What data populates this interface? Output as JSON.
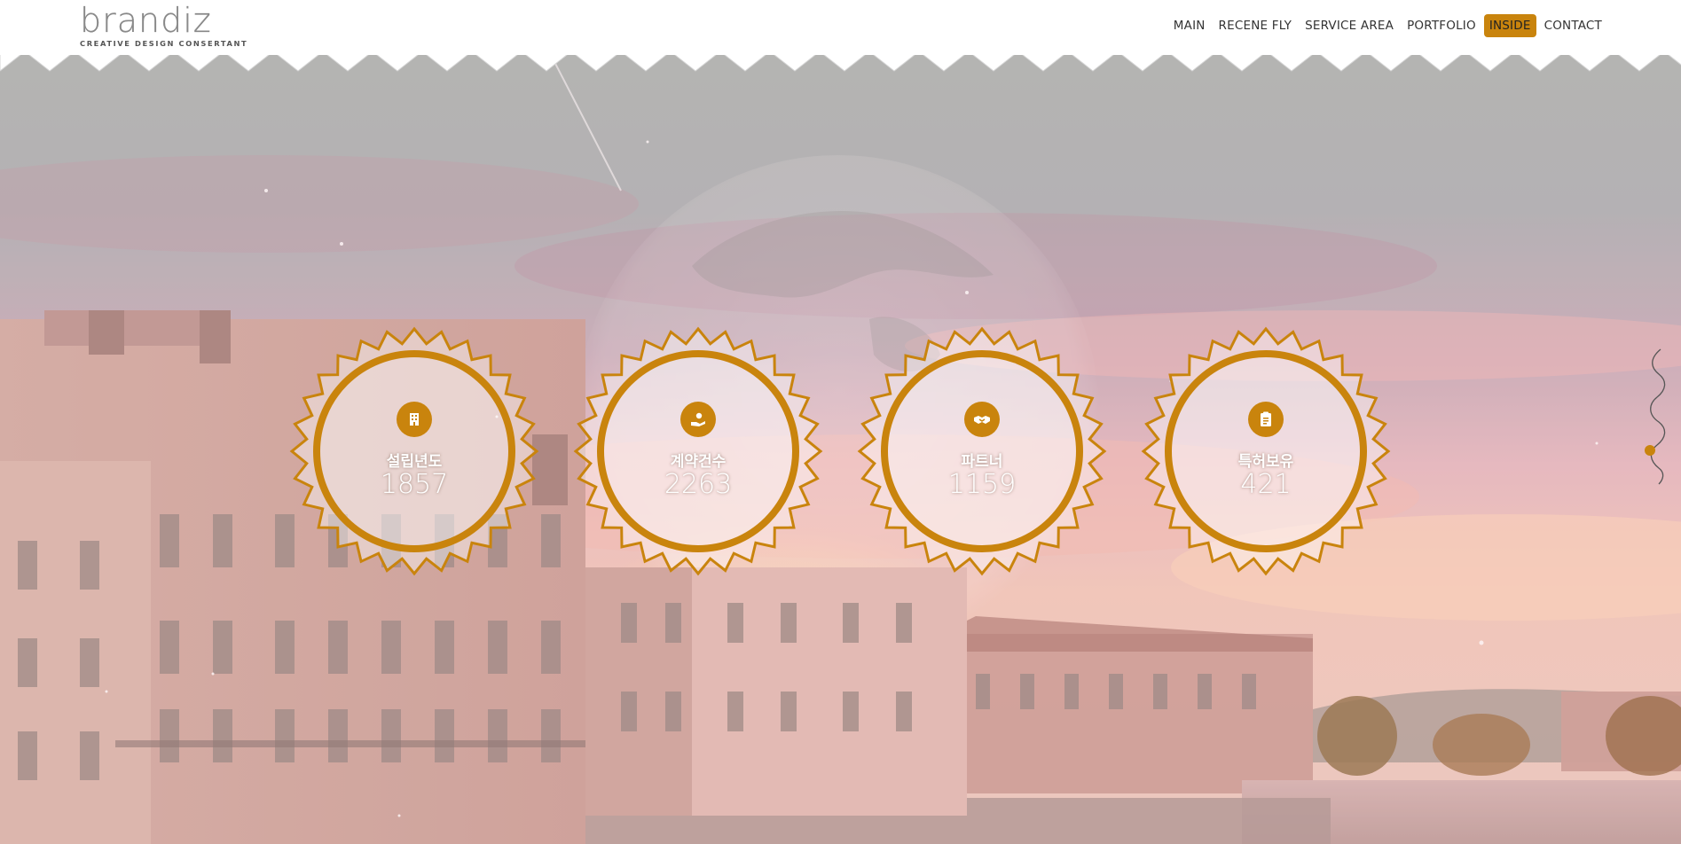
{
  "brand": {
    "name": "brandiz",
    "tagline": "CREATIVE DESIGN CONSERTANT"
  },
  "nav": {
    "items": [
      {
        "label": "MAIN",
        "active": false
      },
      {
        "label": "RECENE FLY",
        "active": false
      },
      {
        "label": "SERVICE AREA",
        "active": false
      },
      {
        "label": "PORTFOLIO",
        "active": false
      },
      {
        "label": "INSIDE",
        "active": true
      },
      {
        "label": "CONTACT",
        "active": false
      }
    ]
  },
  "stats": [
    {
      "icon": "building-icon",
      "label": "설립년도",
      "value": "1857"
    },
    {
      "icon": "money-hand-icon",
      "label": "계약건수",
      "value": "2263"
    },
    {
      "icon": "handshake-icon",
      "label": "파트너",
      "value": "1159"
    },
    {
      "icon": "document-icon",
      "label": "특허보유",
      "value": "421"
    }
  ],
  "colors": {
    "accent": "#c9840d",
    "header_bg": "#ffffff"
  },
  "pager": {
    "pages": 3,
    "active_index": 2
  }
}
